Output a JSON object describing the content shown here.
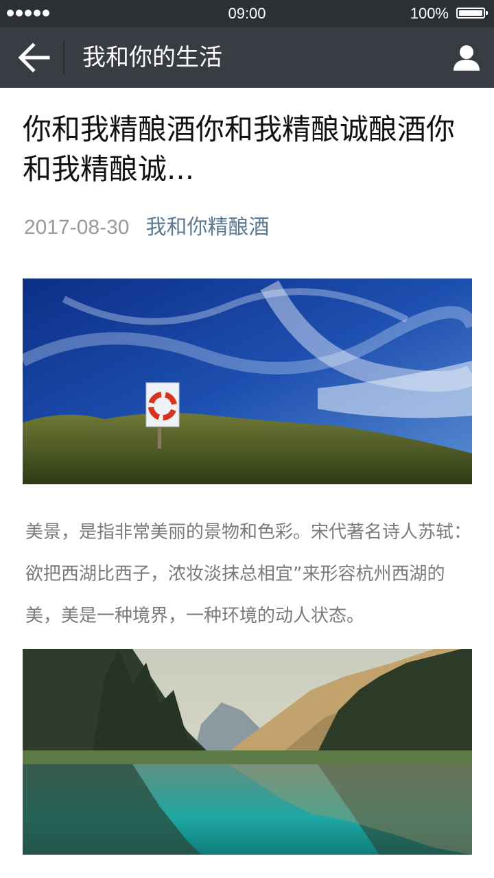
{
  "status_bar": {
    "time": "09:00",
    "battery_percent": "100%",
    "signal_icon": "signal-dots",
    "battery_icon": "battery-full"
  },
  "nav": {
    "title": "我和你的生活",
    "back_icon": "arrow-left-icon",
    "profile_icon": "person-icon"
  },
  "article": {
    "title": "你和我精酿酒你和我精酿诚酿酒你和我精酿诚...",
    "date": "2017-08-30",
    "account": "我和你精酿酒",
    "paragraph": "美景，是指非常美丽的景物和色彩。宋代著名诗人苏轼：欲把西湖比西子，浓妆淡抹总相宜”来形容杭州西湖的美，美是一种境界，一种环境的动人状态。"
  },
  "colors": {
    "status_bar": "#2c2f34",
    "nav_bar": "#393c42",
    "account_link": "#5c7a94",
    "date_text": "#9a9a9a",
    "body_text": "#7a7a7a"
  }
}
